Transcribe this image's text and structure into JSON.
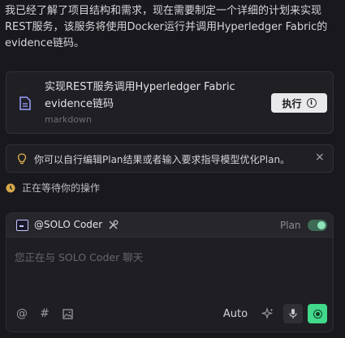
{
  "intro_text": "我已经了解了项目结构和需求，现在需要制定一个详细的计划来实现REST服务，该服务将使用Docker运行并调用Hyperledger Fabric的evidence链码。",
  "plan_card": {
    "title": "实现REST服务调用Hyperledger Fabric evidence链码",
    "subtitle": "markdown",
    "execute_label": "执行",
    "icon": "document-icon"
  },
  "tip": {
    "text": "你可以自行编辑Plan结果或者输入要求指导模型优化Plan。",
    "close_symbol": "×",
    "icon": "lightbulb-icon"
  },
  "status": {
    "text": "正在等待你的操作",
    "icon": "clock-icon",
    "icon_color": "#d7a84a"
  },
  "chat": {
    "agent_name": "@SOLO Coder",
    "plan_label": "Plan",
    "plan_toggle_on": true,
    "input_placeholder": "您正在与 SOLO Coder 聊天",
    "input_value": "",
    "mode_label": "Auto",
    "at_symbol": "@",
    "hash_symbol": "#"
  },
  "colors": {
    "background": "#19191d",
    "card": "#202024",
    "accent_green": "#41d98c"
  }
}
